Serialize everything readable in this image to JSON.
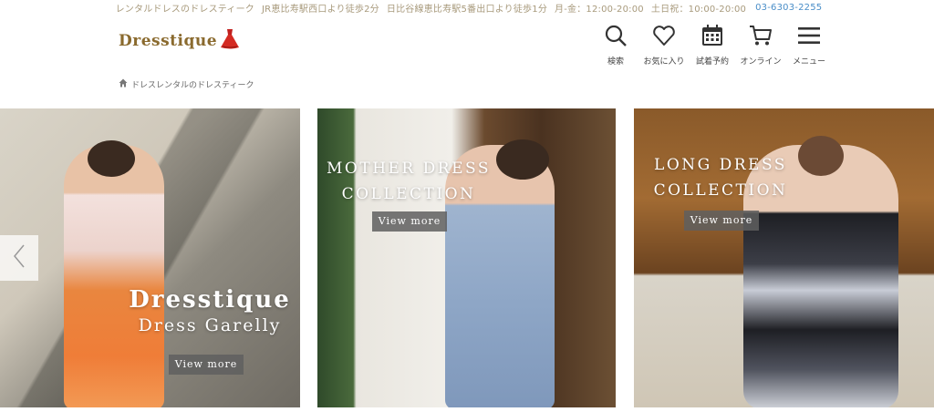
{
  "topbar": {
    "items": [
      "レンタルドレスのドレスティーク",
      "JR恵比寿駅西口より徒歩2分",
      "日比谷線恵比寿駅5番出口より徒歩1分",
      "月-金：12:00-20:00",
      "土日祝：10:00-20:00"
    ],
    "phone": "03-6303-2255"
  },
  "logo": {
    "text": "Dresstique",
    "icon": "red-dress-icon"
  },
  "nav": [
    {
      "label": "検索",
      "icon": "search-icon"
    },
    {
      "label": "お気に入り",
      "icon": "heart-icon"
    },
    {
      "label": "試着予約",
      "icon": "calendar-icon"
    },
    {
      "label": "オンライン",
      "icon": "cart-icon"
    },
    {
      "label": "メニュー",
      "icon": "menu-icon"
    }
  ],
  "breadcrumb": {
    "icon": "home-icon",
    "label": "ドレスレンタルのドレスティーク"
  },
  "slides": [
    {
      "title": "Dresstique",
      "subtitle": "Dress Garelly",
      "button": "View more"
    },
    {
      "line1": "Mother Dress",
      "line2": "Collection",
      "button": "View more"
    },
    {
      "line1": "Long Dress",
      "line2": "Collection",
      "button": "View more"
    }
  ],
  "colors": {
    "accent_gold": "#8a6a2e",
    "topbar_text": "#a89a7c",
    "phone": "#4a8ec8"
  }
}
